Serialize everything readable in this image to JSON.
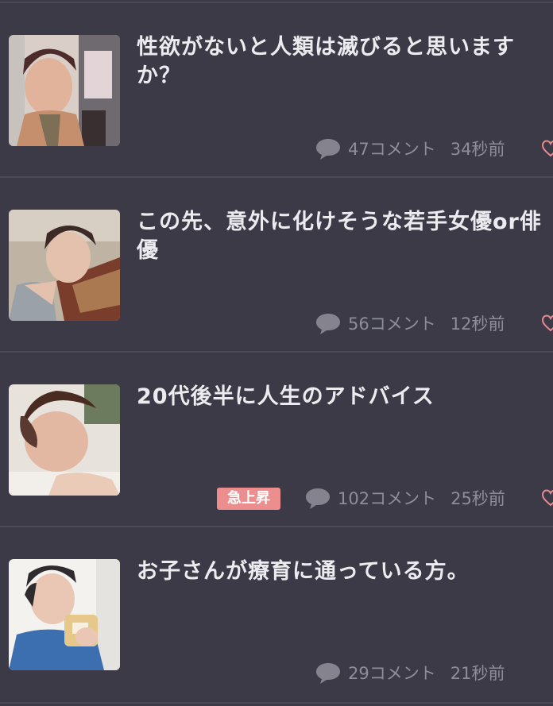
{
  "colors": {
    "background": "#3b3a46",
    "title_text": "#ececf0",
    "meta_text": "#8e8d98",
    "badge_bg": "#ec8e8e",
    "heart": "#e88a92"
  },
  "topics": [
    {
      "title": "性欲がないと人類は滅びると思います\nか？",
      "comments": "47コメント",
      "time": "34秒前",
      "badge": ""
    },
    {
      "title": "この先、意外に化けそうな若手女優or俳\n優",
      "comments": "56コメント",
      "time": "12秒前",
      "badge": ""
    },
    {
      "title": "20代後半に人生のアドバイス",
      "comments": "102コメント",
      "time": "25秒前",
      "badge": "急上昇"
    },
    {
      "title": "お子さんが療育に通っている方。",
      "comments": "29コメント",
      "time": "21秒前",
      "badge": ""
    }
  ],
  "icons": {
    "comment": "comment-bubble-icon",
    "favorite": "heart-outline-icon"
  }
}
